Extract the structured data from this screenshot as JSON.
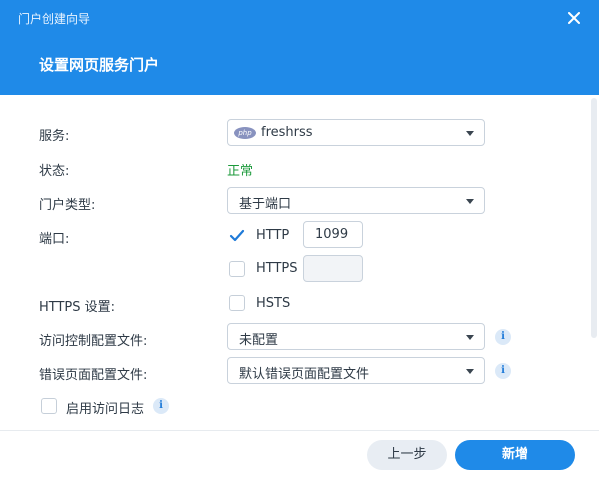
{
  "window": {
    "title": "门户创建向导",
    "close_icon": "close-icon"
  },
  "header": {
    "title": "设置网页服务门户"
  },
  "form": {
    "service": {
      "label": "服务:",
      "value": "freshrss",
      "icon": "php-icon",
      "icon_text": "php"
    },
    "status": {
      "label": "状态:",
      "value": "正常",
      "color": "#1c9a3b"
    },
    "portal_type": {
      "label": "门户类型:",
      "value": "基于端口"
    },
    "port": {
      "label": "端口:",
      "http": {
        "label": "HTTP",
        "checked": true,
        "value": "1099"
      },
      "https": {
        "label": "HTTPS",
        "checked": false,
        "value": ""
      }
    },
    "https_settings": {
      "label": "HTTPS 设置:",
      "hsts": {
        "label": "HSTS",
        "checked": false
      }
    },
    "access_control": {
      "label": "访问控制配置文件:",
      "value": "未配置"
    },
    "error_page": {
      "label": "错误页面配置文件:",
      "value": "默认错误页面配置文件"
    },
    "access_log": {
      "label": "启用访问日志",
      "checked": false
    }
  },
  "footer": {
    "prev_label": "上一步",
    "add_label": "新增"
  },
  "colors": {
    "accent": "#1f8ae8",
    "info_bg": "#dbe9f8"
  }
}
